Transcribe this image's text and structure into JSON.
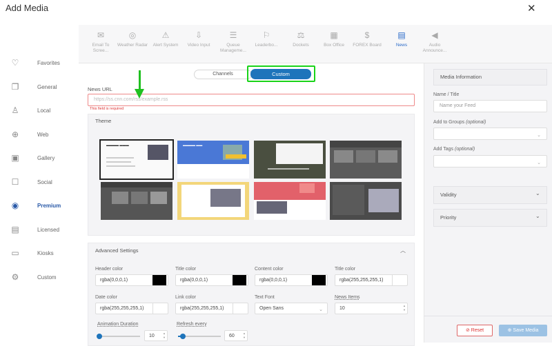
{
  "modal": {
    "title": "Add Media",
    "close_icon": "close-icon"
  },
  "sidebar": {
    "items": [
      {
        "label": "Favorites",
        "icon": "heart-star-icon",
        "glyph": "♡"
      },
      {
        "label": "General",
        "icon": "copy-icon",
        "glyph": "❐"
      },
      {
        "label": "Local",
        "icon": "user-icon",
        "glyph": "♙"
      },
      {
        "label": "Web",
        "icon": "globe-icon",
        "glyph": "⊕"
      },
      {
        "label": "Gallery",
        "icon": "gallery-icon",
        "glyph": "▣"
      },
      {
        "label": "Social",
        "icon": "chat-icon",
        "glyph": "☐"
      },
      {
        "label": "Premium",
        "icon": "premium-icon",
        "glyph": "◉"
      },
      {
        "label": "Licensed",
        "icon": "licensed-icon",
        "glyph": "▤"
      },
      {
        "label": "Kiosks",
        "icon": "kiosk-icon",
        "glyph": "▭"
      },
      {
        "label": "Custom",
        "icon": "gear-icon",
        "glyph": "⚙"
      }
    ],
    "active": "Premium"
  },
  "topbar": {
    "items": [
      {
        "label": "Email To Scree...",
        "icon": "email-icon",
        "glyph": "✉"
      },
      {
        "label": "Weather Radar",
        "icon": "radar-icon",
        "glyph": "◎"
      },
      {
        "label": "Alert System",
        "icon": "alert-icon",
        "glyph": "⚠"
      },
      {
        "label": "Video Input",
        "icon": "video-input-icon",
        "glyph": "⇩"
      },
      {
        "label": "Queue Manageme...",
        "icon": "queue-icon",
        "glyph": "☰"
      },
      {
        "label": "Leaderbo...",
        "icon": "bookmark-icon",
        "glyph": "⚐"
      },
      {
        "label": "Dockets",
        "icon": "scales-icon",
        "glyph": "⚖"
      },
      {
        "label": "Box Office",
        "icon": "box-office-icon",
        "glyph": "▦"
      },
      {
        "label": "FOREX Board",
        "icon": "dollar-icon",
        "glyph": "$"
      },
      {
        "label": "News",
        "icon": "news-icon",
        "glyph": "▤"
      },
      {
        "label": "Audio Announce...",
        "icon": "megaphone-icon",
        "glyph": "◀"
      }
    ],
    "active": "News"
  },
  "source_toggle": {
    "channels": "Channels",
    "custom": "Custom"
  },
  "news_url": {
    "label": "News URL",
    "placeholder": "https://ss.cnn.com/rss/example.rss",
    "error": "This field is required"
  },
  "theme": {
    "title": "Theme",
    "thumbnails": [
      {
        "style": "light",
        "selected": true
      },
      {
        "style": "blue",
        "selected": false
      },
      {
        "style": "dark-olive",
        "selected": false
      },
      {
        "style": "gray",
        "selected": false
      },
      {
        "style": "dark-gray",
        "selected": false
      },
      {
        "style": "yellow",
        "selected": false
      },
      {
        "style": "red",
        "selected": false
      },
      {
        "style": "charcoal",
        "selected": false
      }
    ]
  },
  "advanced": {
    "title": "Advanced Settings",
    "header_color": {
      "label": "Header color",
      "value": "rgba(0,0,0,1)",
      "swatch": "#000000"
    },
    "title_color_1": {
      "label": "Title color",
      "value": "rgba(0,0,0,1)",
      "swatch": "#000000"
    },
    "content_color": {
      "label": "Content color",
      "value": "rgba(0,0,0,1)",
      "swatch": "#000000"
    },
    "title_color_2": {
      "label": "Title color",
      "value": "rgba(255,255,255,1)",
      "swatch": "#ffffff"
    },
    "date_color": {
      "label": "Date color",
      "value": "rgba(255,255,255,1)",
      "swatch": "#ffffff"
    },
    "link_color": {
      "label": "Link color",
      "value": "rgba(255,255,255,1)",
      "swatch": "#ffffff"
    },
    "text_font": {
      "label": "Text Font",
      "value": "Open Sans"
    },
    "news_items": {
      "label": "News Items",
      "value": "10"
    },
    "animation_duration": {
      "label": "Animation Duration",
      "value": "10",
      "level": 0.05
    },
    "refresh_every": {
      "label": "Refresh every",
      "value": "60",
      "level": 0.12
    }
  },
  "right_panel": {
    "media_info_title": "Media Information",
    "name_label": "Name / Title",
    "name_placeholder": "Name your Feed",
    "groups_label": "Add to Groups",
    "groups_optional": "(optional)",
    "tags_label": "Add Tags",
    "tags_optional": "(optional)",
    "validity": "Validity",
    "priority": "Priority",
    "reset": "Reset",
    "save": "Save Media"
  },
  "colors": {
    "accent": "#1e74bb",
    "highlight": "#18d318",
    "error": "#dd3333"
  }
}
